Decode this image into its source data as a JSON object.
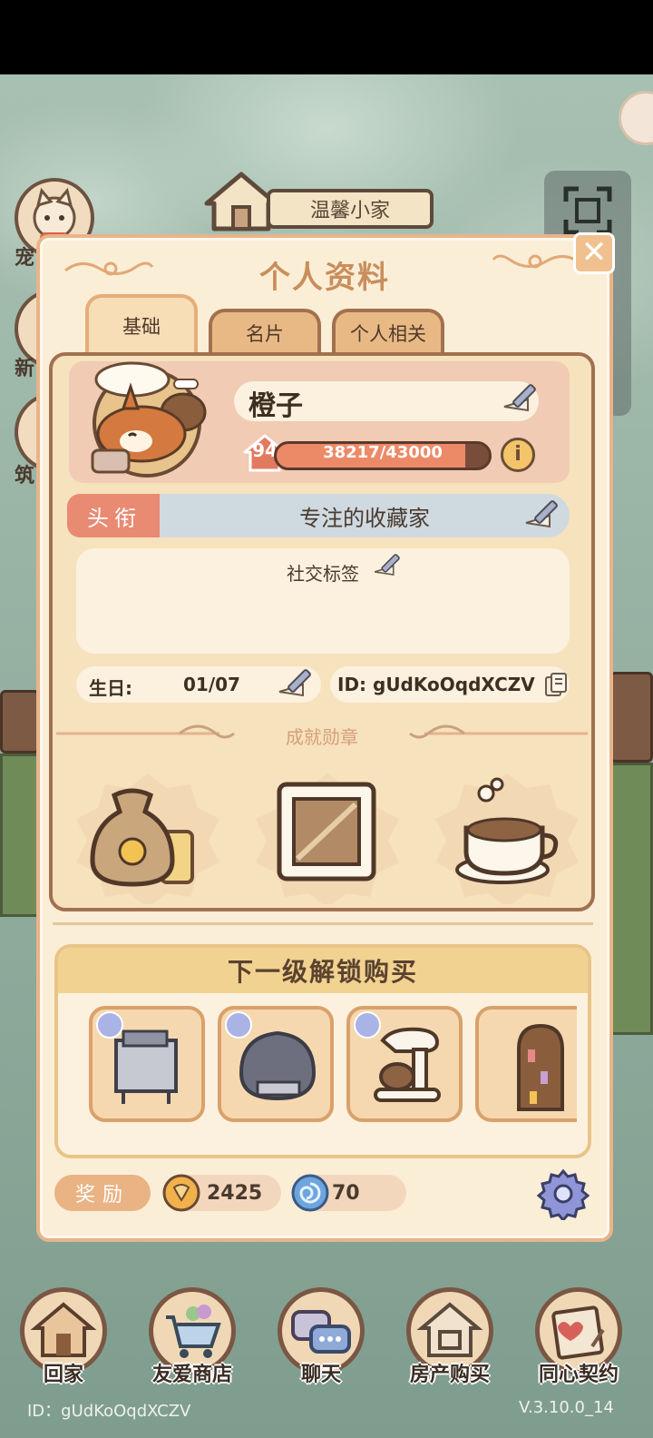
{
  "house": {
    "title": "温馨小家"
  },
  "side_buttons": [
    {
      "label": "宠"
    },
    {
      "label": "新"
    },
    {
      "label": "筑"
    }
  ],
  "panel": {
    "title": "个人资料",
    "tabs": [
      {
        "label": "基础",
        "active": true
      },
      {
        "label": "名片",
        "active": false
      },
      {
        "label": "个人相关",
        "active": false
      }
    ]
  },
  "profile": {
    "name": "橙子",
    "level": "94",
    "xp_text": "38217/43000",
    "xp_fraction": 0.889,
    "title_label": "头衔",
    "title_value": "专注的收藏家",
    "social_label": "社交标签",
    "birthday_label": "生日:",
    "birthday_value": "01/07",
    "id_text": "ID: gUdKoOqdXCZV"
  },
  "achievements": {
    "title": "成就勋章",
    "medals": [
      {
        "icon": "coin-sack-icon"
      },
      {
        "icon": "stamp-icon"
      },
      {
        "icon": "coffee-cup-icon"
      }
    ]
  },
  "next_level": {
    "title": "下一级解锁购买",
    "items": [
      {
        "icon": "deep-fryer-icon"
      },
      {
        "icon": "armchair-icon"
      },
      {
        "icon": "stand-mixer-icon"
      },
      {
        "icon": "arched-shelf-icon"
      }
    ]
  },
  "rewards": {
    "label": "奖励",
    "coins": "2425",
    "gems": "70"
  },
  "bottom_nav": [
    {
      "label": "回家",
      "icon": "house-icon"
    },
    {
      "label": "友爱商店",
      "icon": "shopping-cart-icon"
    },
    {
      "label": "聊天",
      "icon": "chat-bubbles-icon"
    },
    {
      "label": "房产购买",
      "icon": "house-deed-icon"
    },
    {
      "label": "同心契约",
      "icon": "contract-heart-icon"
    }
  ],
  "footer": {
    "id": "ID：gUdKoOqdXCZV",
    "version": "V.3.10.0_14"
  },
  "colors": {
    "panel_bg": "#fbeed7",
    "accent_orange": "#e98a72",
    "frame_brown": "#a1714f"
  }
}
